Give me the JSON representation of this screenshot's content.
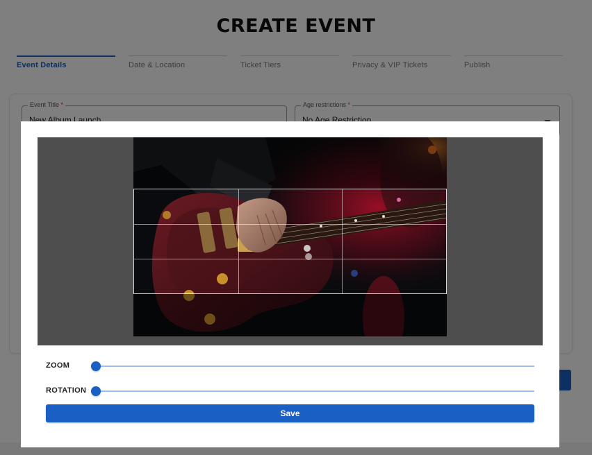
{
  "page": {
    "title": "CREATE EVENT"
  },
  "stepper": {
    "steps": [
      {
        "label": "Event Details",
        "active": true
      },
      {
        "label": "Date & Location",
        "active": false
      },
      {
        "label": "Ticket Tiers",
        "active": false
      },
      {
        "label": "Privacy & VIP Tickets",
        "active": false
      },
      {
        "label": "Publish",
        "active": false
      }
    ]
  },
  "form": {
    "event_title": {
      "label": "Event Title",
      "required_mark": "*",
      "value": "New Album Launch"
    },
    "age_restrictions": {
      "label": "Age restrictions",
      "required_mark": "*",
      "value": "No Age Restriction"
    }
  },
  "cropper": {
    "image_icon": "guitar-photo",
    "grid_visible": true,
    "zoom": {
      "label": "ZOOM",
      "value": 0
    },
    "rotation": {
      "label": "ROTATION",
      "value": 0
    },
    "save_label": "Save"
  },
  "colors": {
    "accent": "#1a5fc4",
    "slider_track": "#9cc0ec",
    "required": "#d32f2f",
    "backdrop": "#000000"
  }
}
